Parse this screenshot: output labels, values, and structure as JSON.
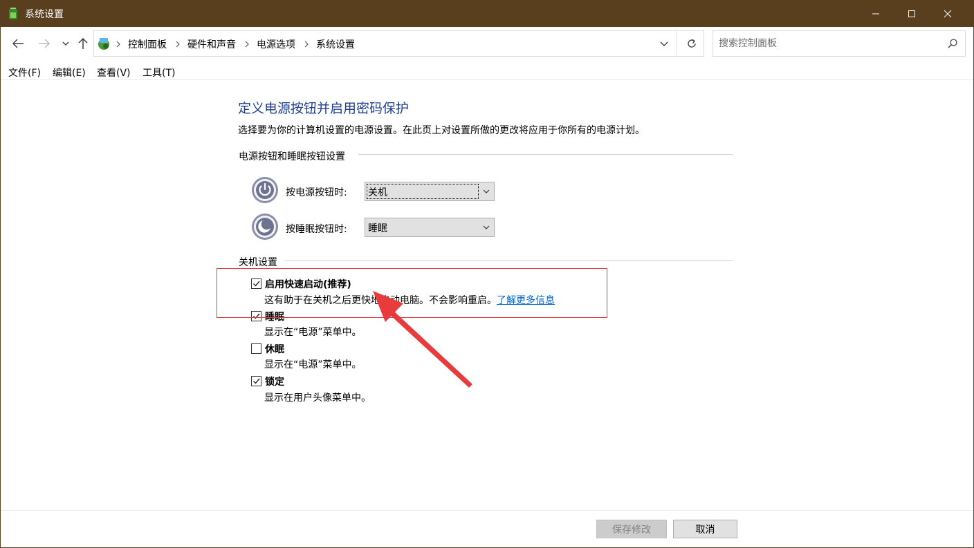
{
  "window": {
    "title": "系统设置",
    "icon": "control-panel-battery-icon"
  },
  "nav": {
    "breadcrumbs": [
      "控制面板",
      "硬件和声音",
      "电源选项",
      "系统设置"
    ],
    "search_placeholder": "搜索控制面板"
  },
  "menu": {
    "items": [
      "文件(F)",
      "编辑(E)",
      "查看(V)",
      "工具(T)"
    ]
  },
  "content": {
    "title": "定义电源按钮并启用密码保护",
    "description": "选择要为你的计算机设置的电源设置。在此页上对设置所做的更改将应用于你所有的电源计划。",
    "power_section": {
      "heading": "电源按钮和睡眠按钮设置",
      "power_button": {
        "label": "按电源按钮时:",
        "value": "关机",
        "icon": "power-icon"
      },
      "sleep_button": {
        "label": "按睡眠按钮时:",
        "value": "睡眠",
        "icon": "sleep-moon-icon"
      }
    },
    "shutdown_section": {
      "heading": "关机设置",
      "options": [
        {
          "title": "启用快速启动(推荐)",
          "desc": "这有助于在关机之后更快地启动电脑。不会影响重启。",
          "link": "了解更多信息",
          "checked": true
        },
        {
          "title": "睡眠",
          "desc": "显示在“电源”菜单中。",
          "checked": true
        },
        {
          "title": "休眠",
          "desc": "显示在“电源”菜单中。",
          "checked": false
        },
        {
          "title": "锁定",
          "desc": "显示在用户头像菜单中。",
          "checked": true
        }
      ]
    }
  },
  "footer": {
    "save_label": "保存修改",
    "cancel_label": "取消"
  },
  "colors": {
    "titlebar": "#5a3f1f",
    "title_text": "#1e3f8f",
    "link": "#0066cc",
    "annotation": "#e03a3a"
  }
}
